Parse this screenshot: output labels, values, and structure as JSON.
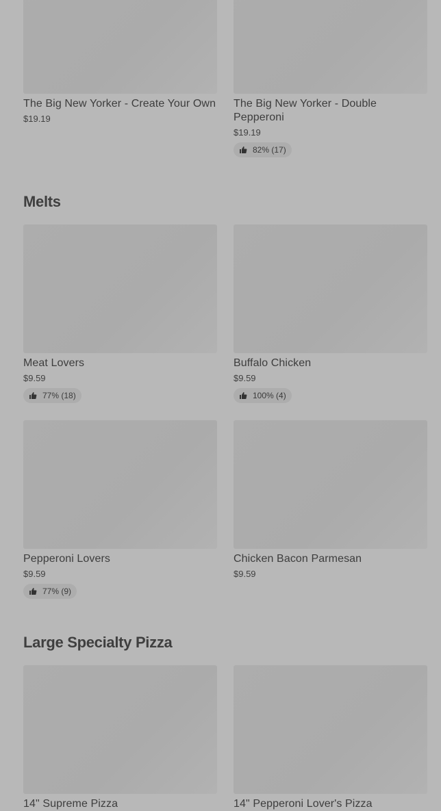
{
  "top_items": [
    {
      "name": "The Big New Yorker - Create Your Own",
      "price": "$19.19",
      "rating": ""
    },
    {
      "name": "The Big New Yorker - Double Pepperoni",
      "price": "$19.19",
      "rating": "82% (17)"
    }
  ],
  "sections": [
    {
      "title": "Melts",
      "items": [
        {
          "name": "Meat Lovers",
          "price": "$9.59",
          "rating": "77% (18)"
        },
        {
          "name": "Buffalo Chicken",
          "price": "$9.59",
          "rating": "100% (4)"
        },
        {
          "name": "Pepperoni Lovers",
          "price": "$9.59",
          "rating": "77% (9)"
        },
        {
          "name": "Chicken Bacon Parmesan",
          "price": "$9.59",
          "rating": ""
        }
      ]
    },
    {
      "title": "Large Specialty Pizza",
      "items": [
        {
          "name": "14\" Supreme Pizza",
          "price": "",
          "rating": ""
        },
        {
          "name": "14\" Pepperoni Lover's Pizza",
          "price": "",
          "rating": ""
        }
      ]
    }
  ],
  "icons": {
    "rating_icon": "thumbs-up-icon"
  }
}
